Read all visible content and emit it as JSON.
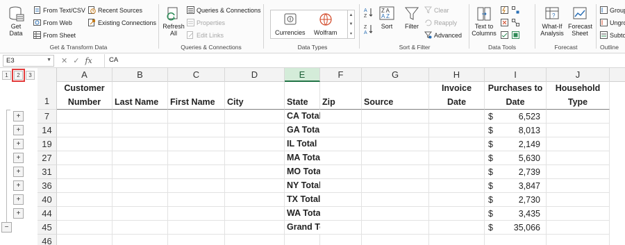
{
  "ribbon": {
    "get_transform": {
      "get_data": "Get Data",
      "from_text_csv": "From Text/CSV",
      "from_web": "From Web",
      "from_sheet": "From Sheet",
      "recent_sources": "Recent Sources",
      "existing_connections": "Existing Connections",
      "label": "Get & Transform Data"
    },
    "queries": {
      "refresh_all": "Refresh All",
      "queries_connections": "Queries & Connections",
      "properties": "Properties",
      "edit_links": "Edit Links",
      "label": "Queries & Connections"
    },
    "data_types": {
      "currencies": "Currencies",
      "wolfram": "Wolfram",
      "label": "Data Types"
    },
    "sort_filter": {
      "sort": "Sort",
      "filter": "Filter",
      "clear": "Clear",
      "reapply": "Reapply",
      "advanced": "Advanced",
      "label": "Sort & Filter"
    },
    "data_tools": {
      "text_to_columns": "Text to Columns",
      "label": "Data Tools"
    },
    "forecast": {
      "what_if": "What-If Analysis",
      "forecast_sheet": "Forecast Sheet",
      "label": "Forecast"
    },
    "outline": {
      "group": "Group",
      "ungroup": "Ungroup",
      "subtotal": "Subtotal",
      "label": "Outline"
    }
  },
  "formula_bar": {
    "name_box": "E3",
    "content": "CA"
  },
  "outline_levels": [
    "1",
    "2",
    "3"
  ],
  "columns": [
    "A",
    "B",
    "C",
    "D",
    "E",
    "F",
    "G",
    "H",
    "I",
    "J"
  ],
  "header_row": {
    "row_number": "1",
    "A": "Customer Number",
    "B": "Last Name",
    "C": "First Name",
    "D": "City",
    "E": "State",
    "F": "Zip",
    "G": "Source",
    "H": "Invoice Date",
    "I": "Purchases to Date",
    "J": "Household Type"
  },
  "rows": [
    {
      "row": "7",
      "label": "CA Total",
      "currency": "$",
      "amount": "6,523",
      "button": "+"
    },
    {
      "row": "14",
      "label": "GA Total",
      "currency": "$",
      "amount": "8,013",
      "button": "+"
    },
    {
      "row": "19",
      "label": "IL Total",
      "currency": "$",
      "amount": "2,149",
      "button": "+"
    },
    {
      "row": "27",
      "label": "MA Total",
      "currency": "$",
      "amount": "5,630",
      "button": "+"
    },
    {
      "row": "31",
      "label": "MO Total",
      "currency": "$",
      "amount": "2,739",
      "button": "+"
    },
    {
      "row": "36",
      "label": "NY Total",
      "currency": "$",
      "amount": "3,847",
      "button": "+"
    },
    {
      "row": "40",
      "label": "TX Total",
      "currency": "$",
      "amount": "2,730",
      "button": "+"
    },
    {
      "row": "44",
      "label": "WA Total",
      "currency": "$",
      "amount": "3,435",
      "button": "+"
    },
    {
      "row": "45",
      "label": "Grand Total",
      "currency": "$",
      "amount": "35,066",
      "button": "−"
    },
    {
      "row": "46",
      "label": "",
      "currency": "",
      "amount": "",
      "button": ""
    }
  ],
  "colors": {
    "selected_header": "#d4ecd9",
    "accent_green": "#217346",
    "highlight_red": "#e23b3b"
  }
}
